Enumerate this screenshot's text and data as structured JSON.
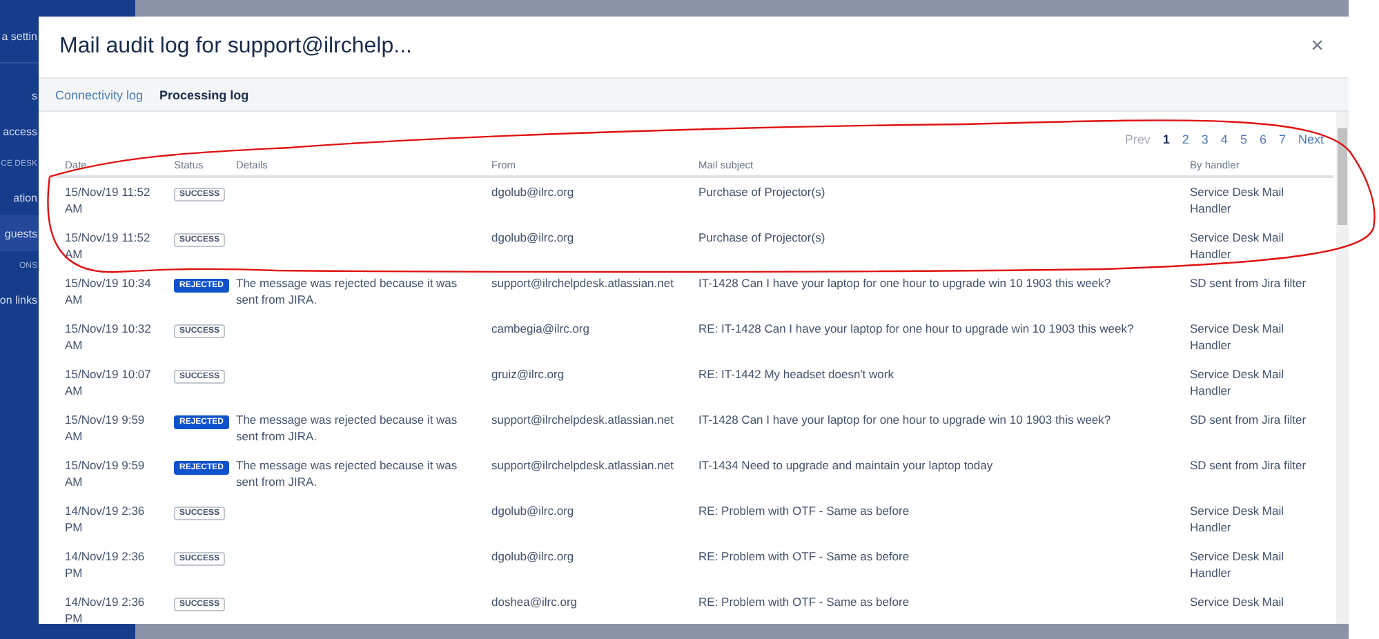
{
  "sidebar": {
    "items": [
      {
        "label": "a settin",
        "kind": "heading",
        "selected": false
      },
      {
        "label": "s",
        "kind": "item",
        "selected": false
      },
      {
        "label": "access",
        "kind": "item",
        "selected": false
      },
      {
        "label": "CE DESK",
        "kind": "section",
        "selected": false
      },
      {
        "label": "ation",
        "kind": "item",
        "selected": false
      },
      {
        "label": "guests",
        "kind": "item",
        "selected": true
      },
      {
        "label": "ONS",
        "kind": "section",
        "selected": false
      },
      {
        "label": "on links",
        "kind": "item",
        "selected": false
      }
    ]
  },
  "dialog": {
    "title": "Mail audit log for support@ilrchelp...",
    "close": "×",
    "tabs": [
      {
        "label": "Connectivity log",
        "selected": false
      },
      {
        "label": "Processing log",
        "selected": true
      }
    ],
    "pagination": {
      "prev": {
        "label": "Prev",
        "disabled": true
      },
      "pages": [
        {
          "label": "1",
          "selected": true
        },
        {
          "label": "2",
          "selected": false
        },
        {
          "label": "3",
          "selected": false
        },
        {
          "label": "4",
          "selected": false
        },
        {
          "label": "5",
          "selected": false
        },
        {
          "label": "6",
          "selected": false
        },
        {
          "label": "7",
          "selected": false
        }
      ],
      "next": {
        "label": "Next",
        "disabled": false
      }
    },
    "table": {
      "columns": [
        "Date",
        "Status",
        "Details",
        "From",
        "Mail subject",
        "By handler"
      ],
      "rows": [
        {
          "date": "15/Nov/19 11:52 AM",
          "status": {
            "label": "SUCCESS",
            "kind": "success"
          },
          "from": "dgolub@ilrc.org",
          "subject": "Purchase of Projector(s)",
          "handler": "Service Desk Mail Handler"
        },
        {
          "date": "15/Nov/19 11:52 AM",
          "status": {
            "label": "SUCCESS",
            "kind": "success"
          },
          "from": "dgolub@ilrc.org",
          "subject": "Purchase of Projector(s)",
          "handler": "Service Desk Mail Handler"
        },
        {
          "date": "15/Nov/19 10:34 AM",
          "status": {
            "label": "REJECTED",
            "kind": "rejected"
          },
          "details": "The message was rejected because it was sent from JIRA.",
          "from": "support@ilrchelpdesk.atlassian.net",
          "subject": "IT-1428 Can I have your laptop for one hour to upgrade win 10 1903 this week?",
          "handler": "SD sent from Jira filter"
        },
        {
          "date": "15/Nov/19 10:32 AM",
          "status": {
            "label": "SUCCESS",
            "kind": "success"
          },
          "from": "cambegia@ilrc.org",
          "subject": "RE: IT-1428 Can I have your laptop for one hour to upgrade win 10 1903 this week?",
          "handler": "Service Desk Mail Handler"
        },
        {
          "date": "15/Nov/19 10:07 AM",
          "status": {
            "label": "SUCCESS",
            "kind": "success"
          },
          "from": "gruiz@ilrc.org",
          "subject": "RE: IT-1442 My headset doesn't work",
          "handler": "Service Desk Mail Handler"
        },
        {
          "date": "15/Nov/19 9:59 AM",
          "status": {
            "label": "REJECTED",
            "kind": "rejected"
          },
          "details": "The message was rejected because it was sent from JIRA.",
          "from": "support@ilrchelpdesk.atlassian.net",
          "subject": "IT-1428 Can I have your laptop for one hour to upgrade win 10 1903 this week?",
          "handler": "SD sent from Jira filter"
        },
        {
          "date": "15/Nov/19 9:59 AM",
          "status": {
            "label": "REJECTED",
            "kind": "rejected"
          },
          "details": "The message was rejected because it was sent from JIRA.",
          "from": "support@ilrchelpdesk.atlassian.net",
          "subject": "IT-1434 Need to upgrade and maintain your laptop today",
          "handler": "SD sent from Jira filter"
        },
        {
          "date": "14/Nov/19 2:36 PM",
          "status": {
            "label": "SUCCESS",
            "kind": "success"
          },
          "from": "dgolub@ilrc.org",
          "subject": "RE: Problem with OTF - Same as before",
          "handler": "Service Desk Mail Handler"
        },
        {
          "date": "14/Nov/19 2:36 PM",
          "status": {
            "label": "SUCCESS",
            "kind": "success"
          },
          "from": "dgolub@ilrc.org",
          "subject": "RE: Problem with OTF - Same as before",
          "handler": "Service Desk Mail Handler"
        },
        {
          "date": "14/Nov/19 2:36 PM",
          "status": {
            "label": "SUCCESS",
            "kind": "success"
          },
          "from": "doshea@ilrc.org",
          "subject": "RE: Problem with OTF - Same as before",
          "handler": "Service Desk Mail"
        }
      ]
    }
  }
}
